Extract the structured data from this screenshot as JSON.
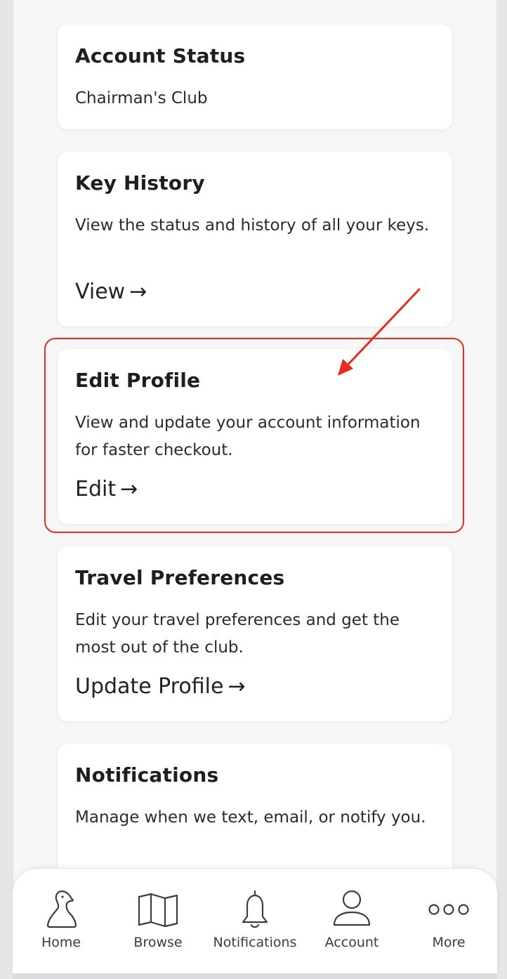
{
  "cards": [
    {
      "title": "Account Status",
      "description": "Chairman's Club"
    },
    {
      "title": "Key History",
      "description": "View the status and history of all your keys.",
      "link_label": "View",
      "link_arrow": "→"
    },
    {
      "title": "Edit Profile",
      "description": "View and update your account information for faster checkout.",
      "link_label": "Edit",
      "link_arrow": "→"
    },
    {
      "title": "Travel Preferences",
      "description": "Edit your travel preferences and get the most out of the club.",
      "link_label": "Update Profile",
      "link_arrow": "→"
    },
    {
      "title": "Notifications",
      "description": "Manage when we text, email, or notify you."
    }
  ],
  "tabbar": {
    "items": [
      {
        "label": "Home",
        "icon": "bird-icon"
      },
      {
        "label": "Browse",
        "icon": "map-icon"
      },
      {
        "label": "Notifications",
        "icon": "bell-icon"
      },
      {
        "label": "Account",
        "icon": "person-icon"
      },
      {
        "label": "More",
        "icon": "dots-icon"
      }
    ]
  },
  "annotation": {
    "color": "#ea2a1b"
  }
}
